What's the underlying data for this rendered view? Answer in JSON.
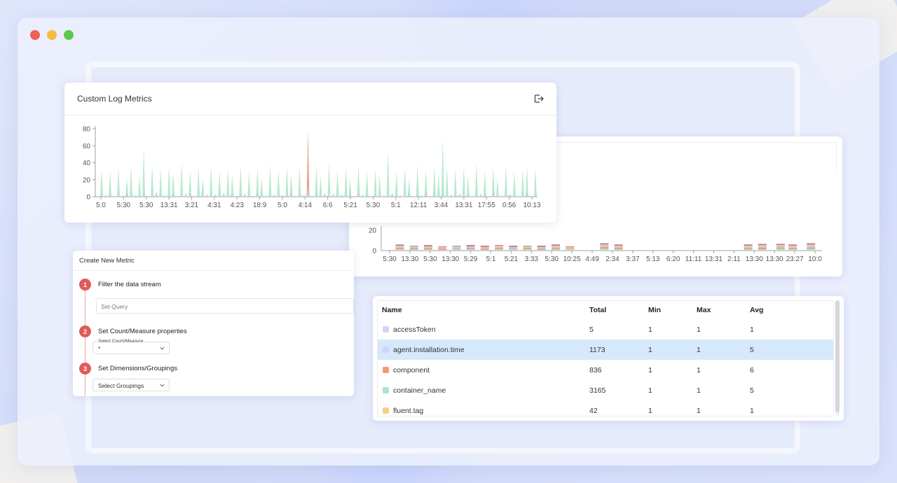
{
  "window": {
    "traffic_lights": {
      "close": "#ef5f58",
      "minimize": "#f5bd3f",
      "zoom": "#5fc750"
    }
  },
  "metrics_panel": {
    "title": "Custom Log Metrics",
    "export_icon": "export-icon",
    "chart_data": {
      "type": "area",
      "yticks": [
        "80",
        "60",
        "40",
        "20",
        "0"
      ],
      "ylim": [
        0,
        80
      ],
      "xticks": [
        "5:0",
        "5:30",
        "5:30",
        "13:31",
        "3:21",
        "4:31",
        "4:23",
        "18:9",
        "5:0",
        "4:14",
        "6:6",
        "5:21",
        "5:30",
        "5:1",
        "12:11",
        "3:44",
        "13:31",
        "17:55",
        "0:56",
        "10:13"
      ],
      "series": [
        {
          "color": "#a8e6c4",
          "values": [
            0,
            32,
            3,
            30,
            0,
            34,
            2,
            22,
            36,
            0,
            25,
            57,
            0,
            38,
            4,
            33,
            0,
            36,
            28,
            0,
            40,
            5,
            31,
            0,
            35,
            22,
            0,
            37,
            3,
            30,
            0,
            33,
            26,
            0,
            36,
            4,
            30,
            0,
            34,
            21,
            0,
            38,
            2,
            32,
            0,
            36,
            27,
            0,
            35,
            3,
            33,
            0,
            36,
            25,
            0,
            40,
            4,
            31,
            0,
            35,
            22,
            0,
            37,
            3,
            30,
            0,
            33,
            26,
            0,
            55,
            4,
            30,
            0,
            34,
            21,
            0,
            38,
            2,
            32,
            0,
            36,
            27,
            68,
            35,
            3,
            33,
            0,
            36,
            25,
            0,
            40,
            4,
            31,
            0,
            35,
            22,
            0,
            37,
            3,
            30,
            0,
            33,
            36,
            0,
            34
          ]
        },
        {
          "color": "#f29a74",
          "values": [
            0,
            0,
            0,
            0,
            0,
            0,
            0,
            0,
            0,
            0,
            0,
            0,
            0,
            0,
            0,
            0,
            0,
            0,
            0,
            0,
            0,
            0,
            0,
            0,
            0,
            0,
            0,
            0,
            0,
            0,
            0,
            0,
            0,
            0,
            0,
            0,
            0,
            0,
            0,
            0,
            0,
            0,
            0,
            0,
            0,
            0,
            0,
            0,
            0,
            0,
            78,
            0,
            0,
            0,
            0,
            0,
            0,
            0,
            0,
            0,
            0,
            0,
            0,
            0,
            0,
            0,
            0,
            0,
            0,
            0,
            0,
            0,
            0,
            0,
            0,
            0,
            0,
            0,
            0,
            0,
            0,
            0,
            0,
            0,
            0,
            0,
            0,
            0,
            0,
            0,
            0,
            0,
            0,
            0,
            0,
            0,
            0,
            0,
            0,
            0,
            0,
            0,
            0,
            0,
            0
          ]
        },
        {
          "color": "#c9c3f2",
          "values": [
            0,
            2,
            0,
            3,
            0,
            2,
            0,
            4,
            0,
            2,
            0,
            3,
            0,
            2,
            6,
            0,
            2,
            0,
            3,
            0,
            2,
            0,
            4,
            0,
            2,
            0,
            3,
            0,
            2,
            0,
            5,
            0,
            2,
            0,
            3,
            0,
            2,
            0,
            4,
            0,
            2,
            0,
            3,
            0,
            2,
            0,
            6,
            0,
            2,
            0,
            14,
            0,
            2,
            0,
            4,
            0,
            2,
            0,
            3,
            0,
            2,
            0,
            5,
            0,
            2,
            0,
            3,
            0,
            2,
            0,
            4,
            0,
            2,
            0,
            3,
            0,
            2,
            0,
            6,
            0,
            2,
            0,
            3,
            0,
            2,
            0,
            4,
            0,
            2,
            0,
            3,
            0,
            2,
            0,
            5,
            0,
            2,
            0,
            3,
            0,
            2,
            0,
            4,
            0,
            2
          ]
        }
      ]
    }
  },
  "stacked_panel": {
    "chart_data": {
      "type": "bar",
      "yticks": [
        "20",
        "0"
      ],
      "ylim": [
        0,
        20
      ],
      "xticks": [
        "5:30",
        "13:30",
        "5:30",
        "13:30",
        "5:29",
        "5:1",
        "5:21",
        "3:33",
        "5:30",
        "10:25",
        "4:49",
        "2:34",
        "3:37",
        "5:13",
        "6:20",
        "11:11",
        "13:31",
        "2:11",
        "13:30",
        "13:30",
        "23:27",
        "10:0"
      ],
      "series_colors": [
        "#a8e6c4",
        "#f29a74",
        "#c9c3f2",
        "#f6c971",
        "#6e8be6",
        "#e65a5a"
      ],
      "groups": [
        {
          "x": 0.5,
          "values": [
            2,
            2,
            2,
            2,
            1,
            1
          ]
        },
        {
          "x": 1.2,
          "values": [
            2,
            2,
            2,
            1,
            1,
            0
          ]
        },
        {
          "x": 1.9,
          "values": [
            2,
            2,
            1,
            2,
            1,
            1
          ]
        },
        {
          "x": 2.6,
          "values": [
            1,
            2,
            2,
            1,
            0,
            1
          ]
        },
        {
          "x": 3.3,
          "values": [
            2,
            1,
            2,
            2,
            1,
            0
          ]
        },
        {
          "x": 4.0,
          "values": [
            2,
            2,
            2,
            1,
            1,
            1
          ]
        },
        {
          "x": 4.7,
          "values": [
            1,
            2,
            1,
            2,
            1,
            1
          ]
        },
        {
          "x": 5.4,
          "values": [
            2,
            2,
            2,
            2,
            0,
            1
          ]
        },
        {
          "x": 6.1,
          "values": [
            2,
            1,
            2,
            1,
            1,
            1
          ]
        },
        {
          "x": 6.8,
          "values": [
            2,
            2,
            1,
            2,
            1,
            0
          ]
        },
        {
          "x": 7.5,
          "values": [
            1,
            2,
            2,
            1,
            1,
            1
          ]
        },
        {
          "x": 8.2,
          "values": [
            2,
            2,
            2,
            2,
            1,
            1
          ]
        },
        {
          "x": 8.9,
          "values": [
            2,
            1,
            1,
            2,
            0,
            1
          ]
        },
        {
          "x": 10.6,
          "values": [
            3,
            3,
            2,
            2,
            1,
            1
          ]
        },
        {
          "x": 11.3,
          "values": [
            2,
            2,
            2,
            2,
            1,
            1
          ]
        },
        {
          "x": 17.7,
          "values": [
            2,
            2,
            2,
            2,
            1,
            1
          ]
        },
        {
          "x": 18.4,
          "values": [
            2,
            3,
            2,
            2,
            1,
            1
          ]
        },
        {
          "x": 19.3,
          "values": [
            3,
            2,
            2,
            2,
            1,
            1
          ]
        },
        {
          "x": 19.9,
          "values": [
            2,
            2,
            2,
            2,
            1,
            1
          ]
        },
        {
          "x": 20.8,
          "values": [
            3,
            2,
            3,
            2,
            1,
            1
          ]
        }
      ]
    }
  },
  "create_metric": {
    "title": "Create New Metric",
    "steps": [
      {
        "num": "1",
        "label": "Filter the data stream"
      },
      {
        "num": "2",
        "label": "Set Count/Measure properties"
      },
      {
        "num": "3",
        "label": "Set Dimensions/Groupings"
      }
    ],
    "query_placeholder": "Set Query",
    "count_select": {
      "floating_label": "Select Count/Measure",
      "value": "*"
    },
    "group_select": {
      "value": "Select Groupings"
    }
  },
  "table": {
    "columns": [
      "Name",
      "Total",
      "Min",
      "Max",
      "Avg"
    ],
    "rows": [
      {
        "color": "#d6d1f5",
        "name": "accessToken",
        "total": "5",
        "min": "1",
        "max": "1",
        "avg": "1",
        "selected": false
      },
      {
        "color": "#d6d1f5",
        "name": "agent.installation.time",
        "total": "1173",
        "min": "1",
        "max": "1",
        "avg": "5",
        "selected": true
      },
      {
        "color": "#f29a74",
        "name": "component",
        "total": "836",
        "min": "1",
        "max": "1",
        "avg": "6",
        "selected": false
      },
      {
        "color": "#a8e6c4",
        "name": "container_name",
        "total": "3165",
        "min": "1",
        "max": "1",
        "avg": "5",
        "selected": false
      },
      {
        "color": "#f6d27f",
        "name": "fluent.tag",
        "total": "42",
        "min": "1",
        "max": "1",
        "avg": "1",
        "selected": false
      }
    ]
  }
}
